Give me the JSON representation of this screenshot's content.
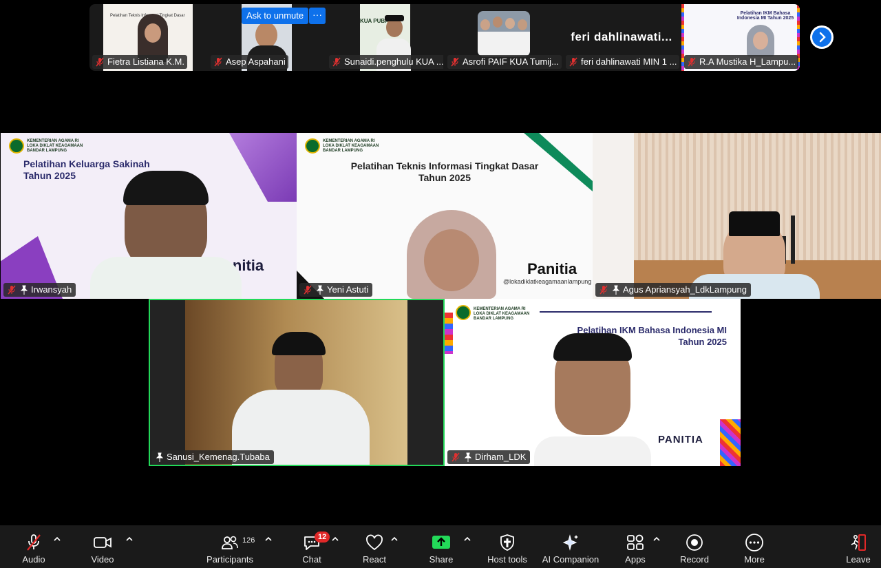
{
  "strip": {
    "thumbs": [
      {
        "label": "Fietra Listiana K.M.",
        "muted": true
      },
      {
        "label": "Asep Aspahani",
        "muted": true
      },
      {
        "label": "Sunaidi.penghulu KUA ...",
        "muted": true
      },
      {
        "label": "Asrofi PAIF KUA Tumij...",
        "muted": true
      },
      {
        "label": "feri dahlinawati MIN 1 ...",
        "name_display": "feri  dahlinawati...",
        "muted": true
      },
      {
        "label": "R.A Mustika H_Lampu...",
        "muted": true
      }
    ],
    "ask_to_unmute": "Ask to unmute",
    "more": "···",
    "thumb_slide_text": "Pelatihan Teknis Informasi Tingkat Dasar",
    "thumb_slide_text2": "Pelatihan IKM Bahasa Indonesia MI Tahun 2025",
    "kua_sign": "KUA PUBA"
  },
  "tiles": [
    {
      "name": "Irwansyah",
      "muted": true,
      "pinned": true,
      "logo": "KEMENTERIAN AGAMA RI LOKA DIKLAT KEAGAMAAN BANDAR LAMPUNG",
      "title1": "Pelatihan Keluarga Sakinah",
      "title2": "Tahun 2025",
      "banner": "Panitia"
    },
    {
      "name": "Yeni Astuti",
      "muted": true,
      "pinned": true,
      "logo": "KEMENTERIAN AGAMA RI LOKA DIKLAT KEAGAMAAN BANDAR LAMPUNG",
      "title1": "Pelatihan Teknis Informasi Tingkat Dasar",
      "title2": "Tahun 2025",
      "banner": "Panitia",
      "handle": "@lokadiklatkeagamaanlampung"
    },
    {
      "name": "Agus Apriansyah_LdkLampung",
      "muted": true,
      "pinned": true
    },
    {
      "name": "Sanusi_Kemenag.Tubaba",
      "muted": false,
      "pinned": true
    },
    {
      "name": "Dirham_LDK",
      "muted": true,
      "pinned": true,
      "logo": "KEMENTERIAN AGAMA RI LOKA DIKLAT KEAGAMAAN BANDAR LAMPUNG",
      "title1": "Pelatihan IKM Bahasa Indonesia MI",
      "title2": "Tahun 2025",
      "banner": "PANITIA"
    }
  ],
  "toolbar": {
    "audio": "Audio",
    "video": "Video",
    "participants": "Participants",
    "participants_count": "126",
    "chat": "Chat",
    "chat_badge": "12",
    "react": "React",
    "share": "Share",
    "host_tools": "Host tools",
    "ai_companion": "AI Companion",
    "apps": "Apps",
    "record": "Record",
    "more": "More",
    "leave": "Leave"
  },
  "colors": {
    "accent": "#0e71eb",
    "active_speaker": "#23d959",
    "share_green": "#23d959",
    "badge_red": "#e02828",
    "leave_red": "#e02828"
  }
}
